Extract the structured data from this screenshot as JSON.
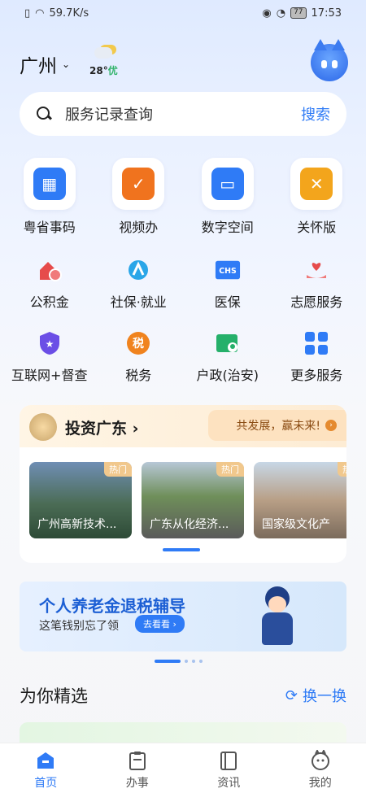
{
  "status_bar": {
    "network_speed": "59.7K/s",
    "battery": "77",
    "time": "17:53"
  },
  "header": {
    "city": "广州",
    "temperature": "28°",
    "air_quality": "优"
  },
  "search": {
    "placeholder": "服务记录查询",
    "button": "搜索"
  },
  "features": [
    {
      "label": "粤省事码",
      "icon": "qr-code-icon",
      "color": "#2f7bf6"
    },
    {
      "label": "视频办",
      "icon": "video-icon",
      "color": "#f0731e"
    },
    {
      "label": "数字空间",
      "icon": "folder-icon",
      "color": "#2f7bf6"
    },
    {
      "label": "关怀版",
      "icon": "ribbon-icon",
      "color": "#f3a51c"
    }
  ],
  "grid_row1": [
    {
      "label": "公积金",
      "icon": "house-fund-icon",
      "color": "#e64b4b"
    },
    {
      "label": "社保·就业",
      "icon": "social-security-icon",
      "color": "#2aa6e8"
    },
    {
      "label": "医保",
      "icon": "medical-insurance-icon",
      "color": "#2f7bf6",
      "glyph": "CHS"
    },
    {
      "label": "志愿服务",
      "icon": "volunteer-icon",
      "color": "#e64b4b"
    }
  ],
  "grid_row2": [
    {
      "label": "互联网+督查",
      "icon": "shield-star-icon",
      "color": "#6b4ee6"
    },
    {
      "label": "税务",
      "icon": "tax-icon",
      "color": "#f0831e",
      "glyph": "税"
    },
    {
      "label": "户政(治安)",
      "icon": "id-card-icon",
      "color": "#25b06a"
    },
    {
      "label": "更多服务",
      "icon": "grid-more-icon",
      "color": "#2f7bf6"
    }
  ],
  "invest": {
    "title": "投资广东",
    "slogan": "共发展，赢未来!",
    "cards": [
      {
        "caption": "广州高新技术...",
        "badge": "热门"
      },
      {
        "caption": "广东从化经济...",
        "badge": "热门"
      },
      {
        "caption": "国家级文化产",
        "badge": "热"
      }
    ]
  },
  "banner": {
    "title": "个人养老金退税辅导",
    "subtitle": "这笔钱别忘了领",
    "button": "去看看"
  },
  "section": {
    "title": "为你精选",
    "action": "换一换"
  },
  "tabs": [
    {
      "label": "首页",
      "icon": "home-icon",
      "active": true
    },
    {
      "label": "办事",
      "icon": "clipboard-icon",
      "active": false
    },
    {
      "label": "资讯",
      "icon": "book-icon",
      "active": false
    },
    {
      "label": "我的",
      "icon": "profile-icon",
      "active": false
    }
  ]
}
